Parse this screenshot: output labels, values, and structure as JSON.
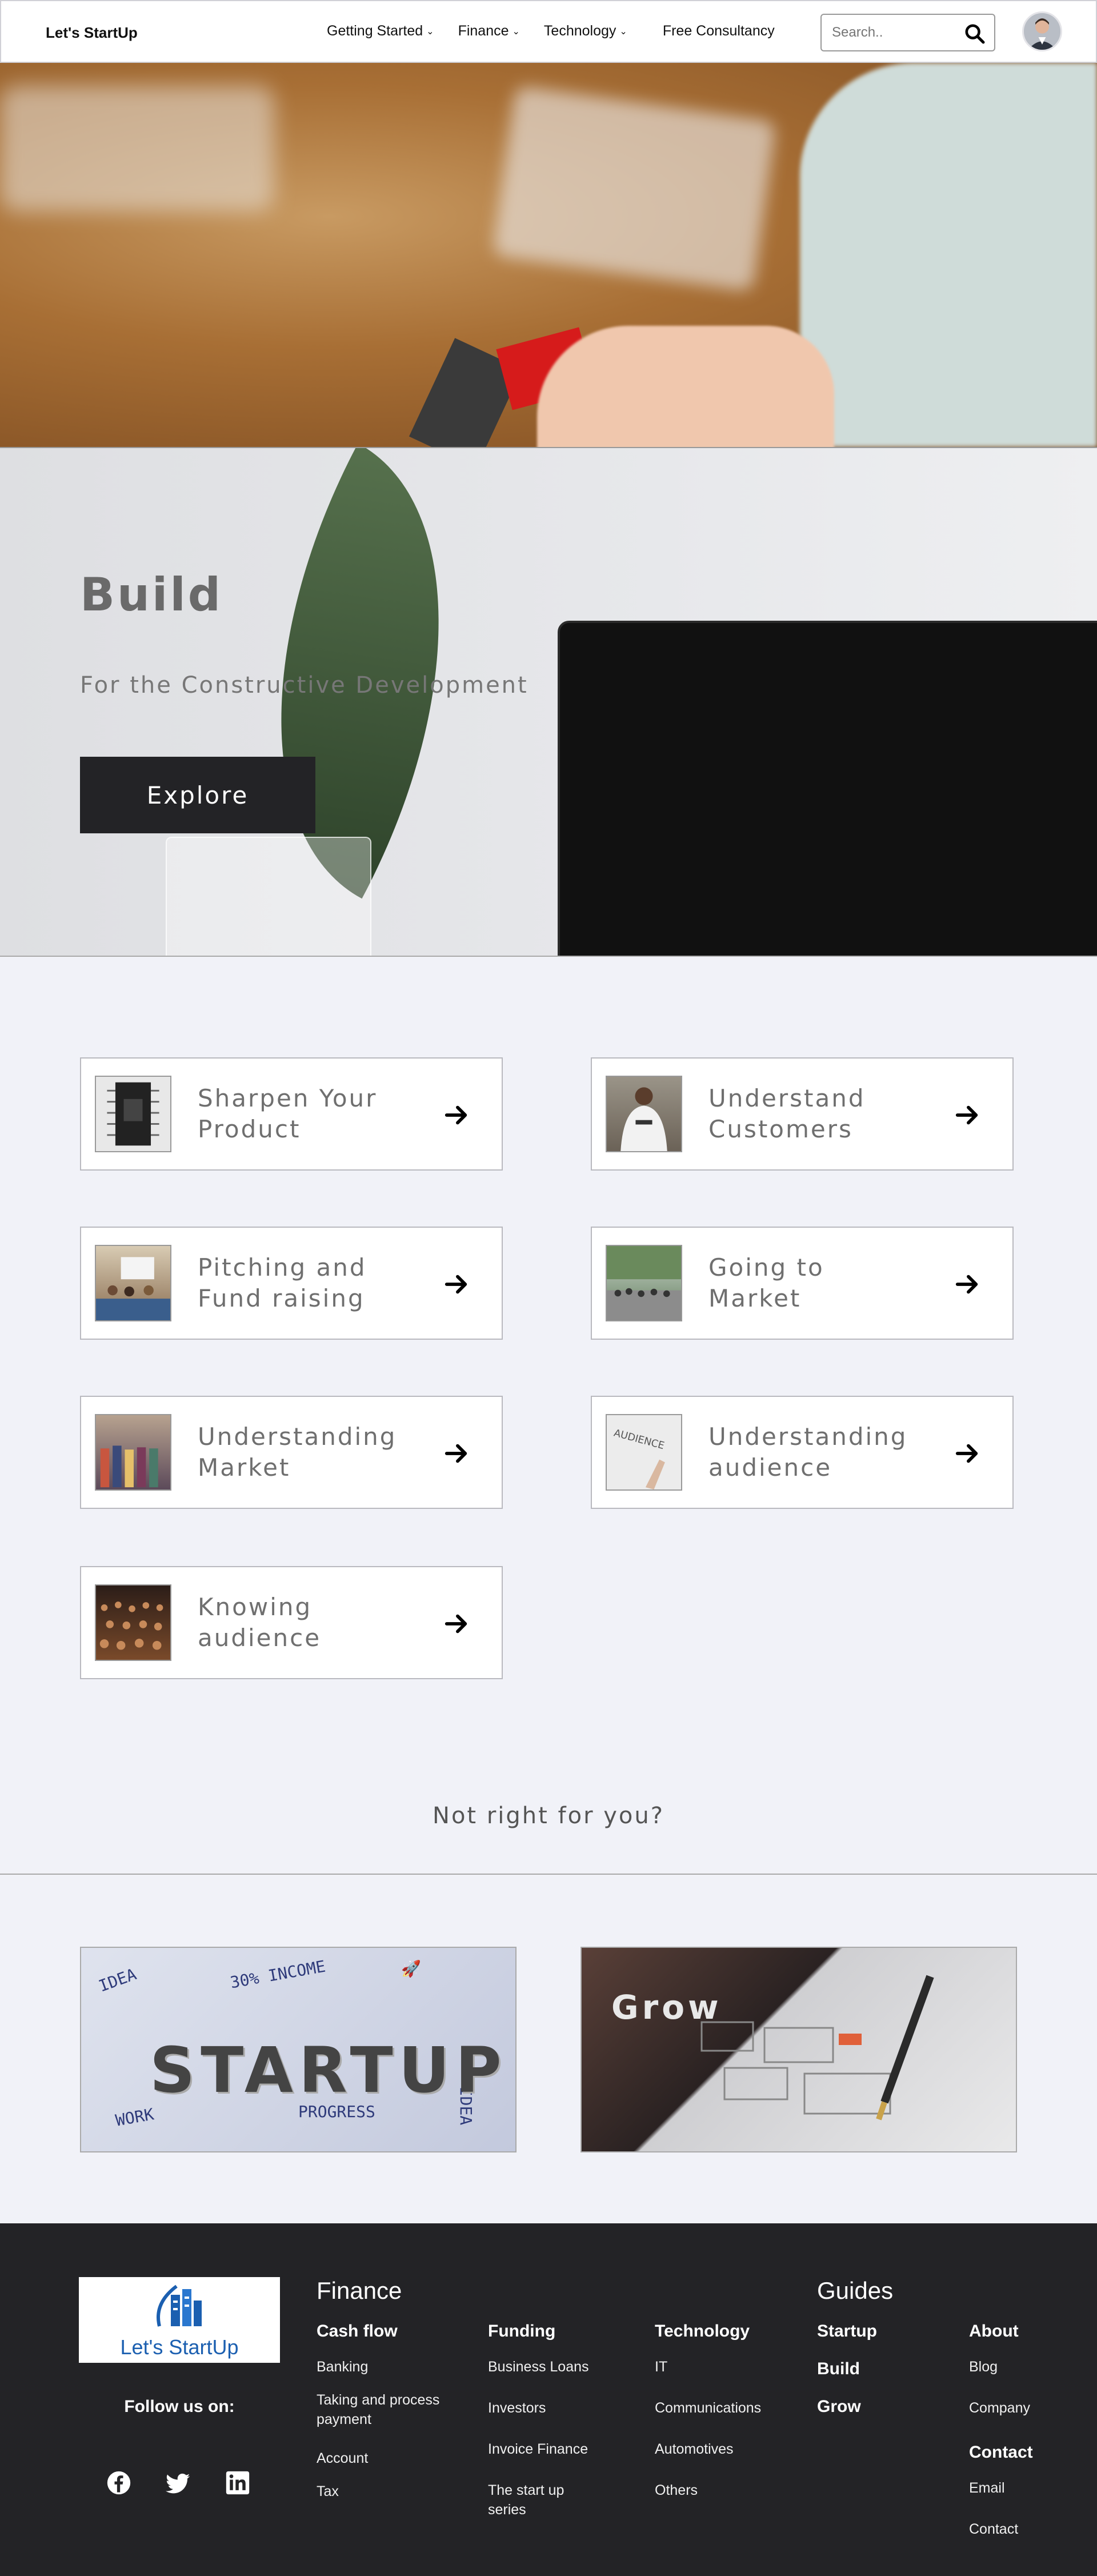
{
  "nav": {
    "brand": "Let's StartUp",
    "menu": [
      {
        "label": "Getting Started",
        "has_dropdown": true
      },
      {
        "label": "Finance",
        "has_dropdown": true
      },
      {
        "label": "Technology",
        "has_dropdown": true
      },
      {
        "label": "Free Consultancy",
        "has_dropdown": false
      }
    ],
    "search_placeholder": "Search.."
  },
  "hero": {
    "title": "Build",
    "subtitle": "For the Constructive Development",
    "button": "Explore"
  },
  "cards": [
    {
      "label": "Sharpen Your Product",
      "thumb": "circuit-chip"
    },
    {
      "label": "Understand Customers",
      "thumb": "person-back"
    },
    {
      "label": "Pitching and Fund raising",
      "thumb": "meeting-room"
    },
    {
      "label": "Going to Market",
      "thumb": "street-crowd"
    },
    {
      "label": "Understanding Market",
      "thumb": "clothes-market"
    },
    {
      "label": "Understanding audience",
      "thumb": "whiteboard-audience"
    },
    {
      "label": "Knowing audience",
      "thumb": "concert-crowd"
    }
  ],
  "not_right": "Not right for you?",
  "tiles": {
    "startup_text": "STARTUP",
    "grow_text": "Grow"
  },
  "footer": {
    "logo_text": "Let's StartUp",
    "follow": "Follow us on:",
    "socials": [
      "facebook-icon",
      "twitter-icon",
      "linkedin-icon"
    ],
    "finance_heading": "Finance",
    "guides_heading": "Guides",
    "columns": [
      {
        "title": "Cash flow",
        "links": [
          "Banking",
          "Taking and process payment",
          "Account",
          "Tax"
        ]
      },
      {
        "title": "Funding",
        "links": [
          "Business Loans",
          "Investors",
          "Invoice Finance",
          "The start up series"
        ]
      },
      {
        "title": "Technology",
        "links": [
          "IT",
          "Communications",
          "Automotives",
          "Others"
        ]
      }
    ],
    "guides": [
      "Startup",
      "Build",
      "Grow"
    ],
    "about": {
      "title": "About",
      "links": [
        "Blog",
        "Company"
      ]
    },
    "contact": {
      "title": "Contact",
      "links": [
        "Email",
        "Contact"
      ]
    }
  },
  "colors": {
    "dark": "#232326",
    "accent_blue": "#1b5fb0",
    "card_border": "#b9b9bf",
    "bg": "#f1f2f8"
  }
}
